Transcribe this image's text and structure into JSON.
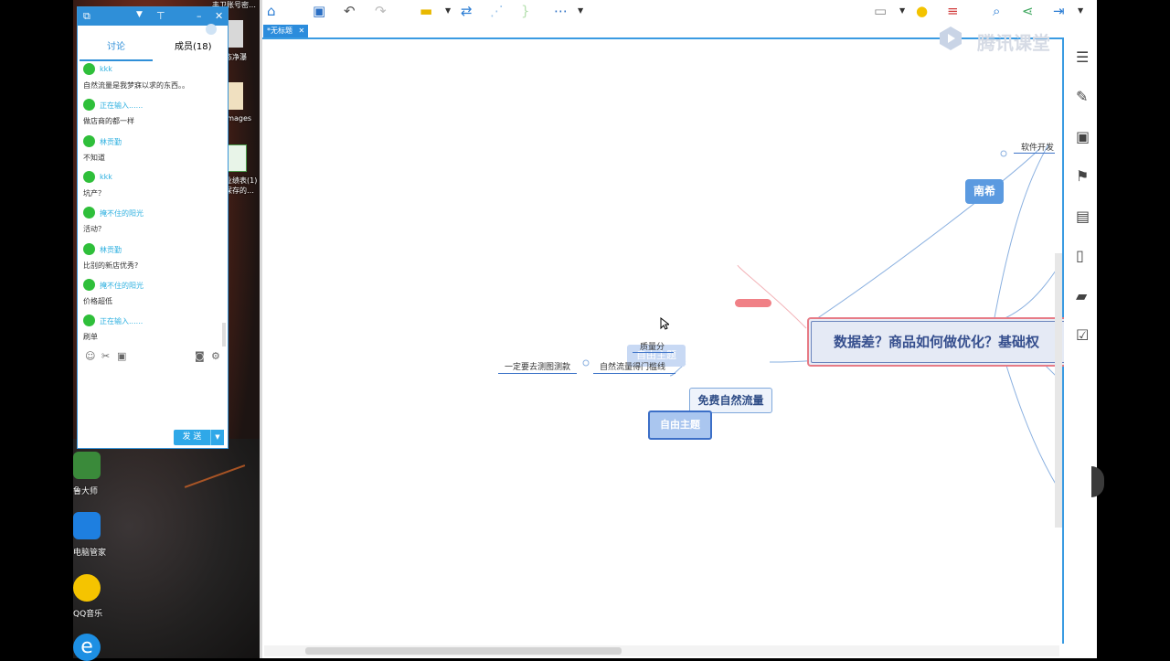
{
  "desktop": {
    "top_items": [
      "丰卫账号密…",
      "态净瀑",
      "images",
      "业绩表(1)",
      "保存的…"
    ],
    "shortcuts": [
      "鲁大师",
      "电脑管家",
      "QQ音乐"
    ]
  },
  "chat": {
    "tabs": [
      {
        "label": "讨论"
      },
      {
        "label": "成员(18)"
      }
    ],
    "messages": [
      {
        "name": "kkk",
        "text": "自然流量是我梦寐以求的东西。。"
      },
      {
        "name": "正在输入......",
        "text": "做店商的都一样"
      },
      {
        "name": "林贡勤",
        "text": "不知道"
      },
      {
        "name": "kkk",
        "text": "坑产？"
      },
      {
        "name": "掩不住的阳光",
        "text": "活动？"
      },
      {
        "name": "林贡勤",
        "text": "比别的新店优秀?"
      },
      {
        "name": "掩不住的阳光",
        "text": "价格超低"
      },
      {
        "name": "正在输入......",
        "text": "刷单"
      }
    ],
    "send_label": "发 送"
  },
  "app": {
    "doc_tab": "*无标题",
    "watermark": "腾讯课堂",
    "nodes": {
      "central": "数据差？商品如何做优化？基础权",
      "nanxi": "南希",
      "software": "软件开发",
      "free_traffic": "免费自然流量",
      "free_topic_1": "自由主题",
      "free_topic_2": "自由主题",
      "quality_score": "质量分",
      "natural_threshold": "自然流量得门槛线",
      "must_test": "一定要去测图测款"
    }
  }
}
